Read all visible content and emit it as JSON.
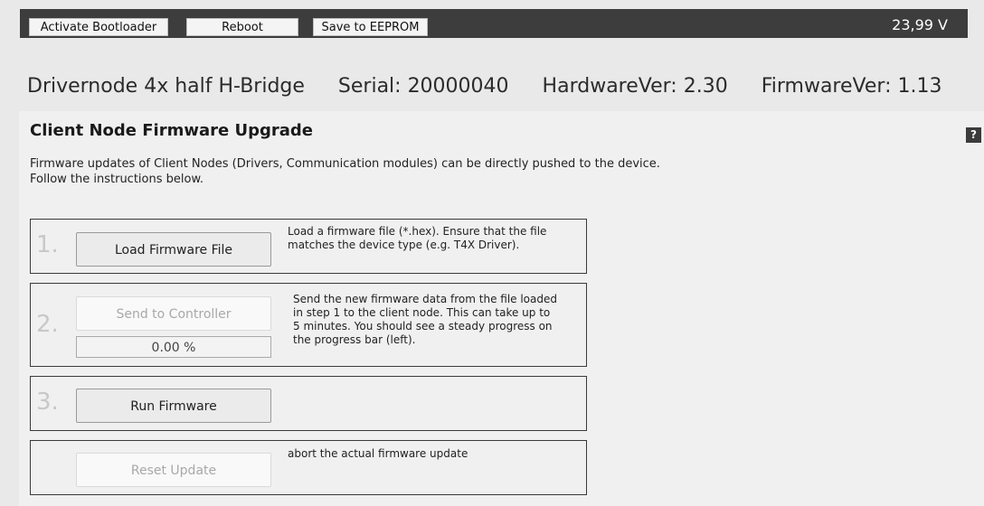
{
  "toolbar": {
    "activate_bootloader": "Activate Bootloader",
    "reboot": "Reboot",
    "save_eeprom": "Save to EEPROM",
    "voltage": "23,99 V"
  },
  "device": {
    "name": "Drivernode 4x half H-Bridge",
    "serial": "Serial: 20000040",
    "hardware": "HardwareVer: 2.30",
    "firmware": "FirmwareVer: 1.13"
  },
  "section": {
    "title": "Client Node Firmware Upgrade",
    "help": "?",
    "desc_line1": "Firmware updates of Client Nodes (Drivers, Communication modules) can be directly pushed to the device.",
    "desc_line2": "Follow the instructions below."
  },
  "steps": {
    "s1": {
      "num": "1.",
      "button": "Load Firmware File",
      "text_line1": "Load a firmware file (*.hex). Ensure that the file",
      "text_line2": "matches the device type (e.g. T4X Driver)."
    },
    "s2": {
      "num": "2.",
      "button": "Send to Controller",
      "progress_label": "0.00 %",
      "progress_value": 0,
      "text_line1": "Send the new firmware data from the file loaded",
      "text_line2": "in step 1 to the client node. This can take up to",
      "text_line3": "5 minutes. You should see a steady progress on",
      "text_line4": "the progress bar (left)."
    },
    "s3": {
      "num": "3.",
      "button": "Run Firmware"
    },
    "s4": {
      "button": "Reset Update",
      "text_line1": "abort the actual firmware update"
    }
  },
  "colors": {
    "toolbar_bg": "#3d3d3d",
    "page_bg": "#e9e9e9",
    "panel_bg": "#f0f0f0",
    "progress_fill": "#4caf50"
  }
}
